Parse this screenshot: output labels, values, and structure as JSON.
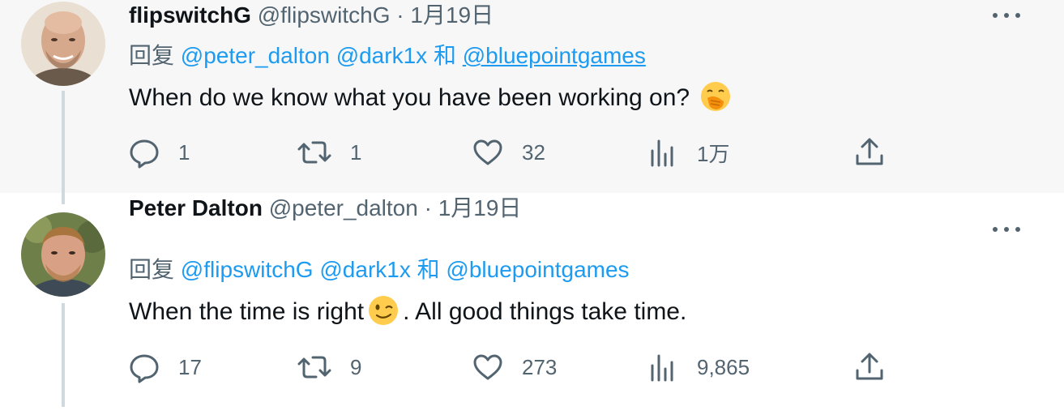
{
  "tweets": [
    {
      "display_name": "flipswitchG",
      "handle": "@flipswitchG",
      "separator": "·",
      "date": "1月19日",
      "reply_prefix": "回复",
      "mentions": [
        "@peter_dalton",
        "@dark1x",
        "@bluepointgames"
      ],
      "mention_conjunction": "和",
      "text_before_emoji": "When do we know what you have been working on?",
      "text_after_emoji": "",
      "emoji": "face-with-hand-over-mouth",
      "stats": {
        "replies": "1",
        "retweets": "1",
        "likes": "32",
        "views": "1万"
      }
    },
    {
      "display_name": "Peter Dalton",
      "handle": "@peter_dalton",
      "separator": "·",
      "date": "1月19日",
      "reply_prefix": "回复",
      "mentions": [
        "@flipswitchG",
        "@dark1x",
        "@bluepointgames"
      ],
      "mention_conjunction": "和",
      "text_before_emoji": "When the time is right",
      "text_after_emoji": ". All good things take time.",
      "emoji": "winking-face",
      "stats": {
        "replies": "17",
        "retweets": "9",
        "likes": "273",
        "views": "9,865"
      }
    }
  ],
  "icons": {
    "reply": "reply-icon",
    "retweet": "retweet-icon",
    "like": "heart-icon",
    "views": "views-icon",
    "share": "share-icon",
    "more": "more-icon"
  },
  "colors": {
    "link": "#1d9bf0",
    "secondary_text": "#536471",
    "primary_text": "#0f1419",
    "thread_line": "#cfd9de",
    "first_tweet_bg": "#f7f7f7"
  }
}
